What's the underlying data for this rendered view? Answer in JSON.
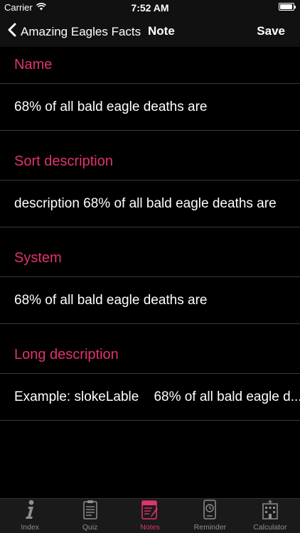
{
  "status_bar": {
    "carrier": "Carrier",
    "time": "7:52 AM",
    "battery_level": 0.95
  },
  "nav": {
    "back_label": "Amazing Eagles Facts",
    "title": "Note",
    "save_label": "Save"
  },
  "fields": [
    {
      "header": "Name",
      "value": "68% of all bald eagle deaths are"
    },
    {
      "header": "Sort description",
      "value": "description 68% of all bald eagle deaths are"
    },
    {
      "header": "System",
      "value": "68% of all bald eagle deaths are"
    },
    {
      "header": "Long description",
      "value": "Example: slokeLable    68% of all bald eagle d..."
    }
  ],
  "tabs": [
    {
      "label": "Index",
      "icon": "info-icon",
      "active": false
    },
    {
      "label": "Quiz",
      "icon": "quiz-icon",
      "active": false
    },
    {
      "label": "Notes",
      "icon": "notes-icon",
      "active": true
    },
    {
      "label": "Reminder",
      "icon": "reminder-icon",
      "active": false
    },
    {
      "label": "Calculator",
      "icon": "calculator-icon",
      "active": false
    }
  ],
  "colors": {
    "accent": "#e0336d",
    "background": "#000000",
    "bar": "#111111"
  }
}
